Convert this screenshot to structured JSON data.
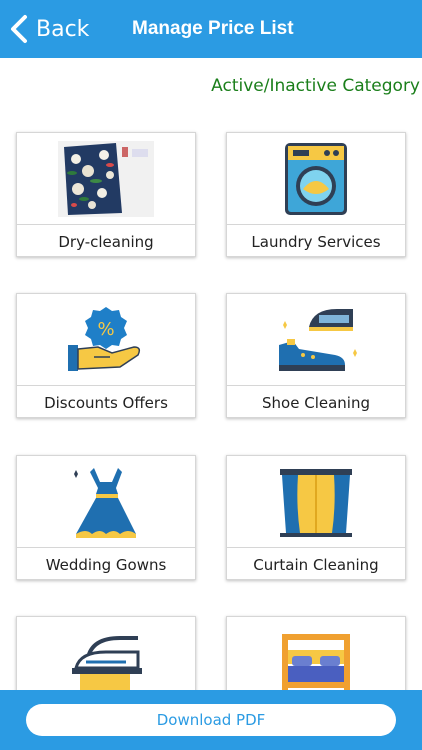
{
  "nav": {
    "back_label": "Back",
    "title": "Manage Price List"
  },
  "active_inactive_label": "Active/Inactive Category",
  "categories": [
    {
      "label": "Dry-cleaning",
      "icon": "clothing-photo-icon"
    },
    {
      "label": "Laundry Services",
      "icon": "washing-machine-icon"
    },
    {
      "label": "Discounts Offers",
      "icon": "discount-hand-icon"
    },
    {
      "label": "Shoe Cleaning",
      "icon": "shoe-iron-icon"
    },
    {
      "label": "Wedding Gowns",
      "icon": "dress-icon"
    },
    {
      "label": "Curtain Cleaning",
      "icon": "curtain-icon"
    },
    {
      "label": "",
      "icon": "ironing-icon"
    },
    {
      "label": "",
      "icon": "bed-icon"
    }
  ],
  "footer": {
    "download_label": "Download PDF"
  },
  "colors": {
    "nav_blue": "#2b9be3",
    "active_green": "#1b7f1b"
  }
}
